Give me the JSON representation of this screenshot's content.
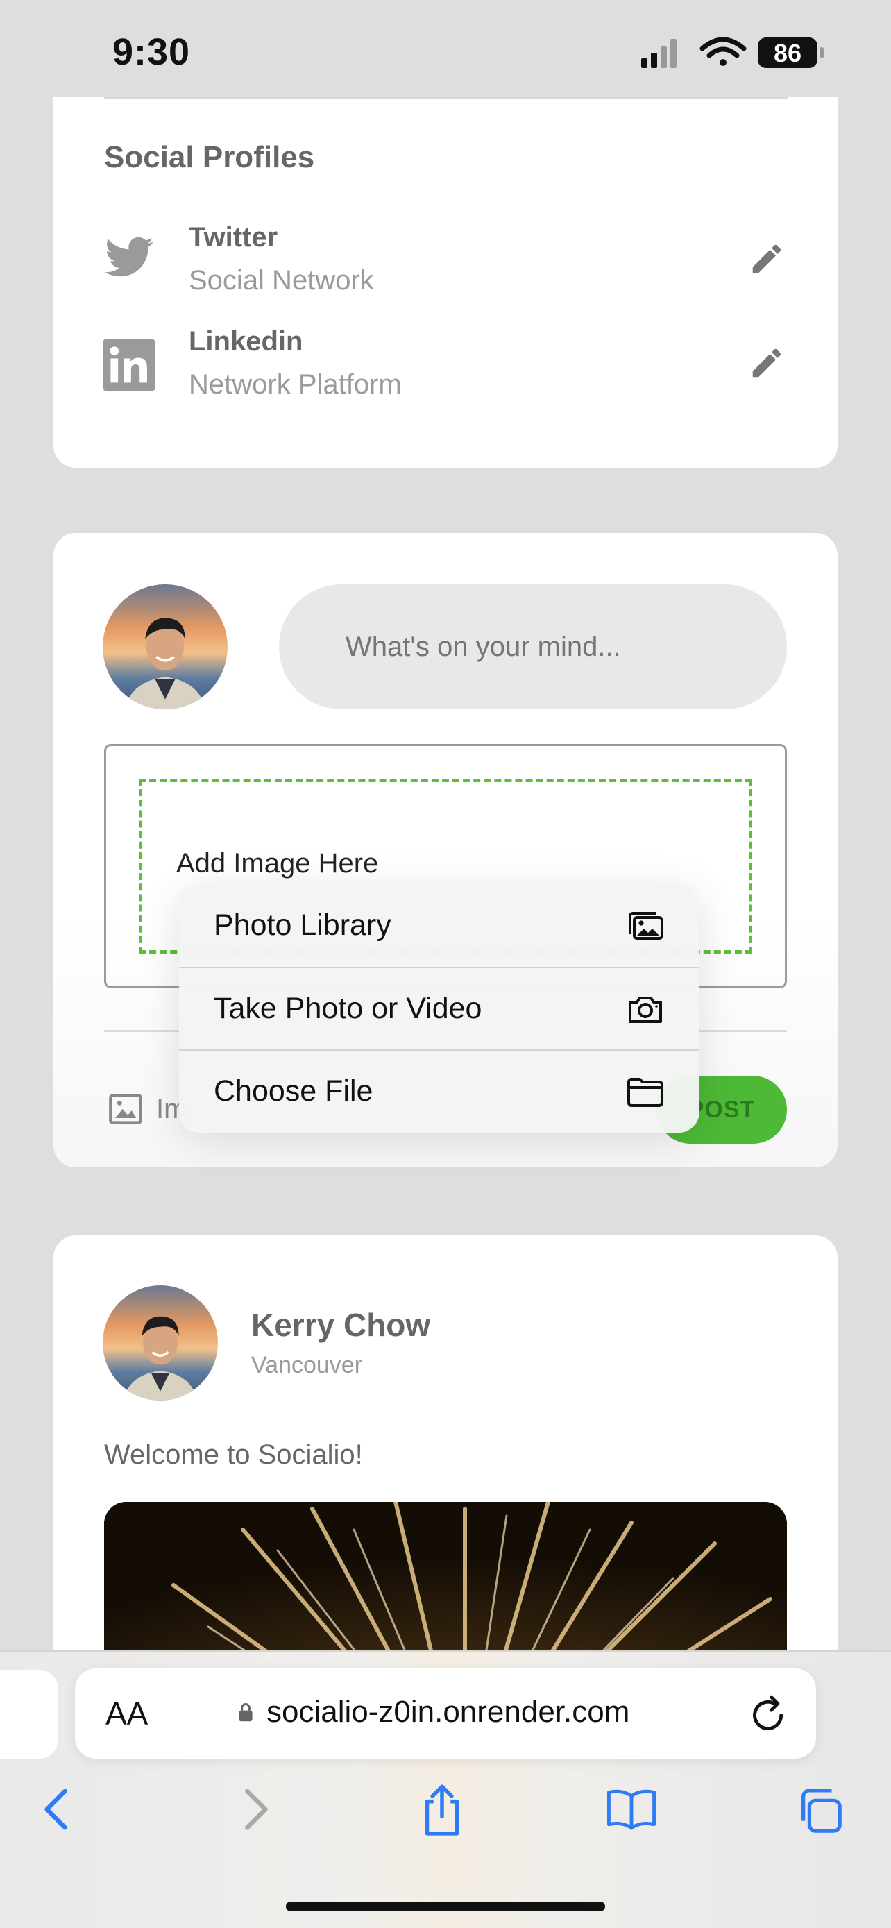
{
  "status": {
    "time": "9:30",
    "battery": "86"
  },
  "social": {
    "title": "Social Profiles",
    "profiles": [
      {
        "name": "Twitter",
        "subtitle": "Social Network",
        "icon": "twitter-icon"
      },
      {
        "name": "Linkedin",
        "subtitle": "Network Platform",
        "icon": "linkedin-icon"
      }
    ]
  },
  "composer": {
    "placeholder": "What's on your mind...",
    "add_image_label": "Add Image Here",
    "image_button_label": "Im",
    "post_button_label": "POST"
  },
  "picker_menu": {
    "items": [
      {
        "label": "Photo Library",
        "icon": "photo-library-icon"
      },
      {
        "label": "Take Photo or Video",
        "icon": "camera-icon"
      },
      {
        "label": "Choose File",
        "icon": "folder-icon"
      }
    ]
  },
  "post": {
    "author": "Kerry Chow",
    "location": "Vancouver",
    "text": "Welcome to Socialio!"
  },
  "browser": {
    "text_size_label": "AA",
    "url": "socialio-z0in.onrender.com"
  },
  "colors": {
    "accent_green": "#4db936",
    "dashed_green": "#5cbf3c",
    "ios_blue": "#2f7bf6"
  }
}
